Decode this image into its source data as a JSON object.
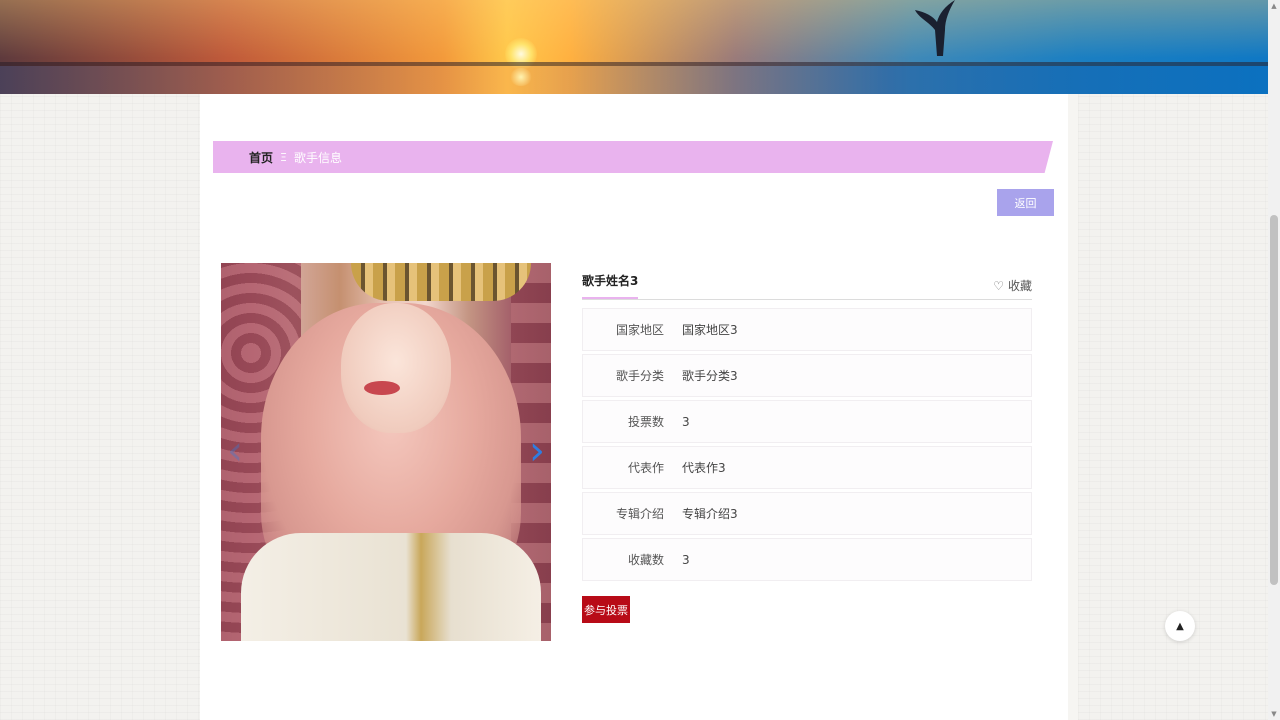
{
  "breadcrumb": {
    "home": "首页",
    "separator": "Ξ",
    "current": "歌手信息"
  },
  "toolbar": {
    "back_label": "返回"
  },
  "carousel": {
    "prev_icon": "chevron-left-icon",
    "next_icon": "chevron-right-icon",
    "prev_glyph": "‹",
    "next_glyph": "›"
  },
  "singer": {
    "name": "歌手姓名3",
    "favorite_label": "收藏",
    "favorite_icon": "heart-outline-icon",
    "fields": [
      {
        "label": "国家地区",
        "value": "国家地区3"
      },
      {
        "label": "歌手分类",
        "value": "歌手分类3"
      },
      {
        "label": "投票数",
        "value": "3"
      },
      {
        "label": "代表作",
        "value": "代表作3"
      },
      {
        "label": "专辑介绍",
        "value": "专辑介绍3"
      },
      {
        "label": "收藏数",
        "value": "3"
      }
    ]
  },
  "actions": {
    "vote_label": "参与投票"
  },
  "scroll": {
    "to_top_icon": "caret-up-icon"
  },
  "colors": {
    "breadcrumb_bg": "#e9b3ee",
    "back_button": "#a9a3ec",
    "vote_button": "#b80b17",
    "carousel_arrow": "#2f7de0"
  }
}
